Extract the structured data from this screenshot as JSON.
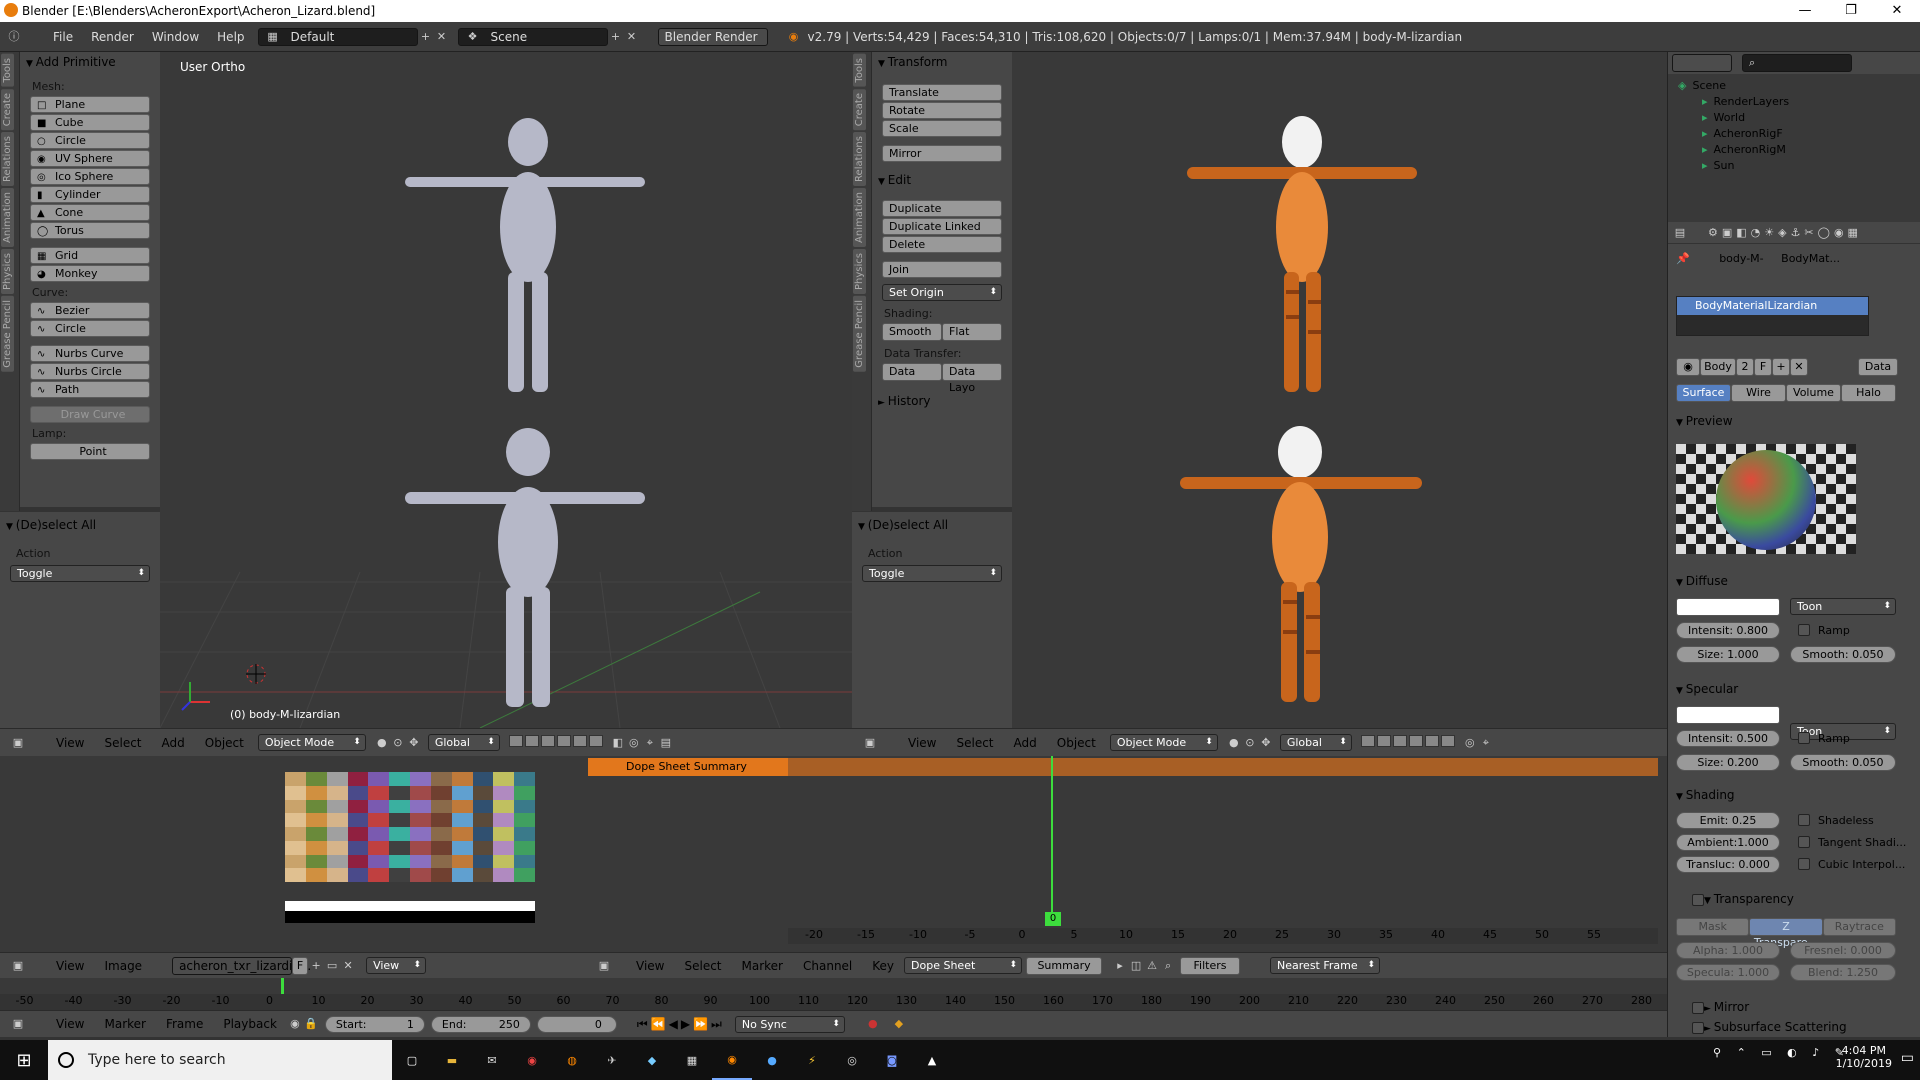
{
  "window": {
    "title": "Blender  [E:\\Blenders\\AcheronExport\\Acheron_Lizard.blend]",
    "min": "—",
    "max": "❐",
    "close": "✕"
  },
  "topbar": {
    "menus": [
      "File",
      "Render",
      "Window",
      "Help"
    ],
    "layout": "Default",
    "scene": "Scene",
    "engine": "Blender Render",
    "stats": "v2.79 | Verts:54,429 | Faces:54,310 | Tris:108,620 | Objects:0/7 | Lamps:0/1 | Mem:37.94M | body-M-lizardian"
  },
  "left_tabs": [
    "Tools",
    "Create",
    "Relations",
    "Animation",
    "Physics",
    "Grease Pencil"
  ],
  "add_primitive": {
    "title": "Add Primitive",
    "mesh_label": "Mesh:",
    "mesh": [
      "Plane",
      "Cube",
      "Circle",
      "UV Sphere",
      "Ico Sphere",
      "Cylinder",
      "Cone",
      "Torus",
      "Grid",
      "Monkey"
    ],
    "curve_label": "Curve:",
    "curve": [
      "Bezier",
      "Circle",
      "Nurbs Curve",
      "Nurbs Circle",
      "Path"
    ],
    "draw_curve": "Draw Curve",
    "lamp_label": "Lamp:",
    "lamp": [
      "Point"
    ]
  },
  "deselect_left": {
    "title": "(De)select All",
    "action_label": "Action",
    "action_value": "Toggle"
  },
  "viewport_left": {
    "view_label": "User Ortho",
    "object_label": "(0) body-M-lizardian"
  },
  "vp_header": {
    "menus": [
      "View",
      "Select",
      "Add",
      "Object"
    ],
    "mode": "Object Mode",
    "orientation": "Global"
  },
  "right_tabs": [
    "Tools",
    "Create",
    "Relations",
    "Animation",
    "Physics",
    "Grease Pencil"
  ],
  "transform_panel": {
    "title": "Transform",
    "buttons": [
      "Translate",
      "Rotate",
      "Scale",
      "Mirror"
    ]
  },
  "edit_panel": {
    "title": "Edit",
    "buttons": [
      "Duplicate",
      "Duplicate Linked",
      "Delete",
      "Join"
    ],
    "set_origin": "Set Origin",
    "shading_label": "Shading:",
    "smooth": "Smooth",
    "flat": "Flat",
    "transfer_label": "Data Transfer:",
    "data": "Data",
    "data_layo": "Data Layo"
  },
  "history_panel": {
    "title": "History"
  },
  "deselect_right": {
    "title": "(De)select All",
    "action_label": "Action",
    "action_value": "Toggle"
  },
  "outliner": {
    "items": [
      "Scene",
      "RenderLayers",
      "World",
      "AcheronRigF",
      "AcheronRigM",
      "Sun"
    ]
  },
  "properties": {
    "breadcrumb": [
      "body-M-",
      "BodyMat..."
    ],
    "material_slot": "BodyMaterialLizardian",
    "mat_name": "Body",
    "users": "2",
    "f": "F",
    "data_sel": "Data",
    "tabs": [
      "Surface",
      "Wire",
      "Volume",
      "Halo"
    ],
    "preview": "Preview",
    "diffuse": {
      "title": "Diffuse",
      "shader": "Toon",
      "intensity": "Intensit: 0.800",
      "ramp": "Ramp",
      "size": "Size:     1.000",
      "smooth": "Smooth: 0.050"
    },
    "specular": {
      "title": "Specular",
      "shader": "Toon",
      "intensity": "Intensit: 0.500",
      "ramp": "Ramp",
      "size": "Size:     0.200",
      "smooth": "Smooth: 0.050"
    },
    "shading": {
      "title": "Shading",
      "emit": "Emit:        0.25",
      "ambient": "Ambient:1.000",
      "transluc": "Transluc: 0.000",
      "shadeless": "Shadeless",
      "tangent": "Tangent Shadi...",
      "cubic": "Cubic Interpol..."
    },
    "transparency": {
      "title": "Transparency",
      "mask": "Mask",
      "ztrans": "Z Transpare...",
      "raytrace": "Raytrace",
      "alpha": "Alpha:    1.000",
      "fresnel": "Fresnel:  0.000",
      "specula": "Specula:  1.000",
      "blend": "Blend:    1.250"
    },
    "mirror": "Mirror",
    "sss": "Subsurface Scattering"
  },
  "image_editor": {
    "menus": [
      "View",
      "Image"
    ],
    "image_name": "acheron_txr_lizardia...",
    "f": "F",
    "view": "View"
  },
  "dopesheet": {
    "summary": "Dope Sheet Summary",
    "menus": [
      "View",
      "Select",
      "Marker",
      "Channel",
      "Key"
    ],
    "mode": "Dope Sheet",
    "summary_btn": "Summary",
    "filters": "Filters",
    "snap": "Nearest Frame",
    "frame": "0",
    "ticks": [
      "-20",
      "-15",
      "-10",
      "-5",
      "0",
      "5",
      "10",
      "15",
      "20",
      "25",
      "30",
      "35",
      "40",
      "45",
      "50",
      "55"
    ]
  },
  "timeline": {
    "ticks": [
      "-50",
      "-40",
      "-30",
      "-20",
      "-10",
      "0",
      "10",
      "20",
      "30",
      "40",
      "50",
      "60",
      "70",
      "80",
      "90",
      "100",
      "110",
      "120",
      "130",
      "140",
      "150",
      "160",
      "170",
      "180",
      "190",
      "200",
      "210",
      "220",
      "230",
      "240",
      "250",
      "260",
      "270",
      "280"
    ],
    "menus": [
      "View",
      "Marker",
      "Frame",
      "Playback"
    ],
    "start": "Start:",
    "start_val": "1",
    "end": "End:",
    "end_val": "250",
    "current": "0",
    "sync": "No Sync"
  },
  "taskbar": {
    "search": "Type here to search",
    "time": "4:04 PM",
    "date": "1/10/2019"
  },
  "colors": {
    "accent": "#5680c2",
    "orange": "#e2771c",
    "header": "#474747",
    "viewport": "#393939"
  }
}
